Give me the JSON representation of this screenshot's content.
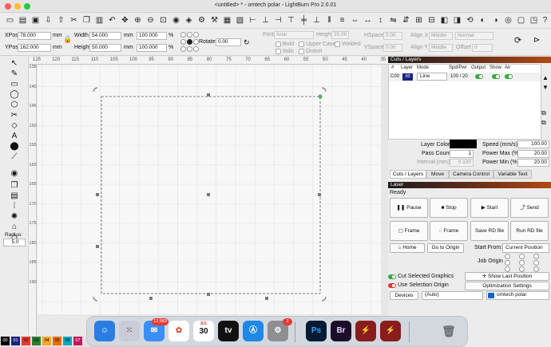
{
  "window": {
    "title": "<untitled> * - omtech polar - LightBurn Pro 2.0.01"
  },
  "edit": {
    "xpos_label": "XPos",
    "xpos_value": "78.000",
    "ypos_label": "YPos",
    "ypos_value": "162.000",
    "unit": "mm",
    "width_label": "Width",
    "width_value": "54.000",
    "height_label": "Height",
    "height_value": "50.000",
    "scale_x": "100.000",
    "scale_y": "100.000",
    "percent": "%",
    "rotate_label": "Rotate",
    "rotate_value": "0.00"
  },
  "text_tool": {
    "font_label": "Font",
    "font_value": "Arial",
    "height_label": "Height",
    "height_value": "25.00",
    "bold": "Bold",
    "italic": "Italic",
    "upper_case": "Upper Case",
    "distort": "Distort",
    "welded": "Welded",
    "hspace_label": "HSpace",
    "hspace_value": "0.00",
    "vspace_label": "VSpace",
    "vspace_value": "0.00",
    "align_x_label": "Align X",
    "align_x_value": "Middle",
    "align_y_label": "Align Y",
    "align_y_value": "Middle",
    "style_value": "Normal",
    "offset_label": "Offset",
    "offset_value": "0"
  },
  "ruler": {
    "top": [
      "125",
      "120",
      "115",
      "110",
      "105",
      "100",
      "95",
      "90",
      "85",
      "80",
      "75",
      "70",
      "65",
      "60",
      "55",
      "50",
      "45",
      "40",
      "35"
    ],
    "left": [
      "135",
      "140",
      "145",
      "150",
      "155",
      "160",
      "165",
      "170",
      "175",
      "180",
      "185",
      "190"
    ]
  },
  "radius": {
    "label": "Radius:",
    "value": "5.0"
  },
  "palette": [
    "00",
    "01",
    "02",
    "03",
    "04",
    "05",
    "06",
    "07"
  ],
  "cuts": {
    "title": "Cuts / Layers",
    "columns": [
      "#",
      "Layer",
      "Mode",
      "Spd/Pwr",
      "Output",
      "Show",
      "Air"
    ],
    "row": {
      "num": "C00",
      "layer": "00",
      "mode": "Line",
      "spdpwr": "100 / 20"
    },
    "layer_color_label": "Layer Color",
    "speed_label": "Speed (mm/s)",
    "speed_value": "100.00",
    "pass_label": "Pass Count",
    "pass_value": "1",
    "pmax_label": "Power Max (%)",
    "pmax_value": "20.00",
    "interval_label": "Interval (mm)",
    "interval_value": "0.100",
    "pmin_label": "Power Min (%)",
    "pmin_value": "20.00"
  },
  "tabs": [
    "Cuts / Layers",
    "Move",
    "Camera Control",
    "Variable Text"
  ],
  "laser": {
    "title": "Laser",
    "status": "Ready",
    "pause": "Pause",
    "stop": "Stop",
    "start": "Start",
    "send": "Send",
    "frame1": "Frame",
    "frame2": "Frame",
    "save_rd": "Save RD file",
    "run_rd": "Run RD file",
    "home": "Home",
    "go_origin": "Go to Origin",
    "start_from_label": "Start From:",
    "start_from_value": "Current Position",
    "job_origin_label": "Job Origin",
    "cut_selected": "Cut Selected Graphics",
    "use_selection": "Use Selection Origin",
    "show_last": "Show Last Position",
    "optimization": "Optimization Settings",
    "devices": "Devices",
    "auto": "(Auto)",
    "device_name": "omtech polar"
  },
  "dock": {
    "mail_badge": "12,583",
    "calendar_month": "JUL",
    "calendar_day": "30",
    "tv_label": "tv",
    "settings_badge": "2",
    "ps_label": "Ps",
    "br_label": "Br"
  },
  "colors": {
    "accent_orange": "#b24a12",
    "toggle_green": "#3da845",
    "selection_green": "#4caf50"
  }
}
